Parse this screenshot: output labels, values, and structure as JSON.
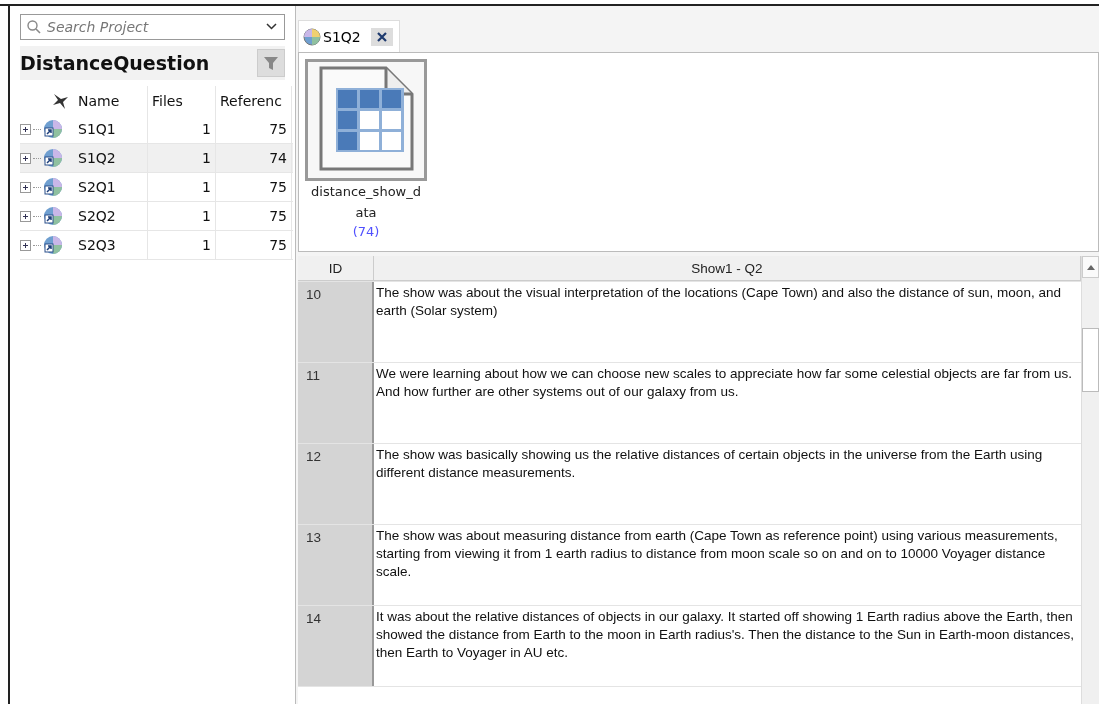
{
  "search": {
    "placeholder": "Search Project"
  },
  "project": {
    "title": "DistanceQuestion"
  },
  "cases_table": {
    "columns": [
      "Name",
      "Files",
      "Referenc"
    ],
    "rows": [
      {
        "name": "S1Q1",
        "files": "1",
        "references": "75",
        "selected": false,
        "expanded": false
      },
      {
        "name": "S1Q2",
        "files": "1",
        "references": "74",
        "selected": true,
        "expanded": false
      },
      {
        "name": "S2Q1",
        "files": "1",
        "references": "75",
        "selected": false,
        "expanded": false
      },
      {
        "name": "S2Q2",
        "files": "1",
        "references": "75",
        "selected": false,
        "expanded": false
      },
      {
        "name": "S2Q3",
        "files": "1",
        "references": "75",
        "selected": false,
        "expanded": false
      }
    ]
  },
  "tabs": [
    {
      "label": "S1Q2",
      "selected": true
    }
  ],
  "file": {
    "name_line_1": "distance_show_d",
    "name_line_2": "ata",
    "count": "(74)"
  },
  "grid": {
    "columns": [
      "ID",
      "Show1 - Q2"
    ],
    "rows": [
      {
        "id": "10",
        "text": "The show was about the visual interpretation of the locations (Cape Town) and also the distance of sun, moon, and earth (Solar system)"
      },
      {
        "id": "11",
        "text": "We were learning about how we can choose new scales to appreciate how far some celestial objects are far from us. And how further are other systems out of our galaxy from us."
      },
      {
        "id": "12",
        "text": "The show was basically showing us the relative distances of certain objects in the universe from the Earth using different distance measurements."
      },
      {
        "id": "13",
        "text": "The show was about measuring distance from earth (Cape Town as reference point) using various measurements, starting from viewing it from 1 earth radius to distance from moon scale so on and on to 10000 Voyager distance scale."
      },
      {
        "id": "14",
        "text": "It was about the relative distances of objects in our galaxy. It started off showing 1 Earth radius above the Earth, then showed the distance from Earth to the moon in Earth radius's. Then the distance to the Sun in Earth-moon distances, then Earth to Voyager in AU etc."
      }
    ]
  }
}
